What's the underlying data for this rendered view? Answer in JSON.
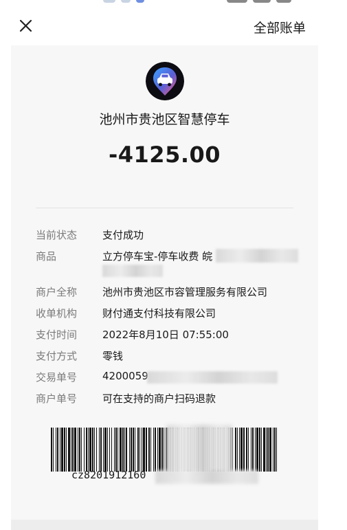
{
  "topbar": {
    "close_icon": "close-icon",
    "all_bills_label": "全部账单"
  },
  "merchant": {
    "logo_icon": "car-parking-logo-icon",
    "name": "池州市贵池区智慧停车"
  },
  "transaction": {
    "amount": "-4125.00"
  },
  "details": [
    {
      "label": "当前状态",
      "value": "支付成功"
    },
    {
      "label": "商品",
      "value": "立方停车宝-停车收费 皖"
    },
    {
      "label": "商户全称",
      "value": "池州市贵池区市容管理服务有限公司"
    },
    {
      "label": "收单机构",
      "value": "财付通支付科技有限公司"
    },
    {
      "label": "支付时间",
      "value": "2022年8月10日 07:55:00"
    },
    {
      "label": "支付方式",
      "value": "零钱"
    },
    {
      "label": "交易单号",
      "value": "4200059"
    },
    {
      "label": "商户单号",
      "value": "可在支持的商户扫码退款"
    }
  ],
  "barcode": {
    "text": "cz8201912160"
  },
  "colors": {
    "background": "#ffffff",
    "card": "#f7f7f7",
    "label": "#7a7a7a",
    "text": "#191919"
  }
}
